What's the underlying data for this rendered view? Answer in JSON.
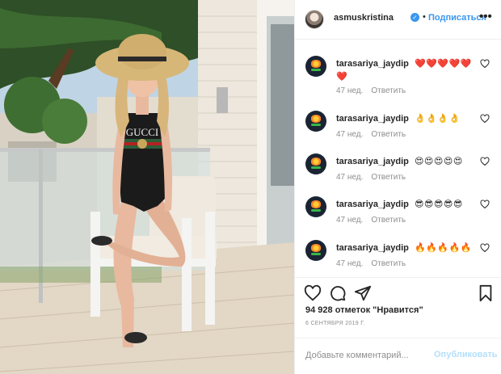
{
  "header": {
    "username": "asmuskristina",
    "follow_label": "Подписаться",
    "separator": "•",
    "more_label": "•••"
  },
  "comments": [
    {
      "user": "tarasariya_jaydip",
      "text": "❤️❤️❤️❤️❤️❤️",
      "time": "47 нед.",
      "reply": "Ответить"
    },
    {
      "user": "tarasariya_jaydip",
      "text": "👌👌👌👌",
      "time": "47 нед.",
      "reply": "Ответить"
    },
    {
      "user": "tarasariya_jaydip",
      "text": "😍😍😍😍😍",
      "time": "47 нед.",
      "reply": "Ответить"
    },
    {
      "user": "tarasariya_jaydip",
      "text": "😎😎😎😎😎",
      "time": "47 нед.",
      "reply": "Ответить"
    },
    {
      "user": "tarasariya_jaydip",
      "text": "🔥🔥🔥🔥🔥",
      "time": "47 нед.",
      "reply": "Ответить"
    }
  ],
  "likes": "94 928 отметок \"Нравится\"",
  "date": "6 СЕНТЯБРЯ 2019 Г.",
  "add_comment": {
    "placeholder": "Добавьте комментарий...",
    "publish_label": "Опубликовать"
  },
  "photo": {
    "swimsuit_text": "GUCCI"
  },
  "colors": {
    "accent": "#3897f0",
    "publish_disabled": "#b2dffc",
    "meta": "#8e8e8e",
    "border": "#efefef"
  }
}
